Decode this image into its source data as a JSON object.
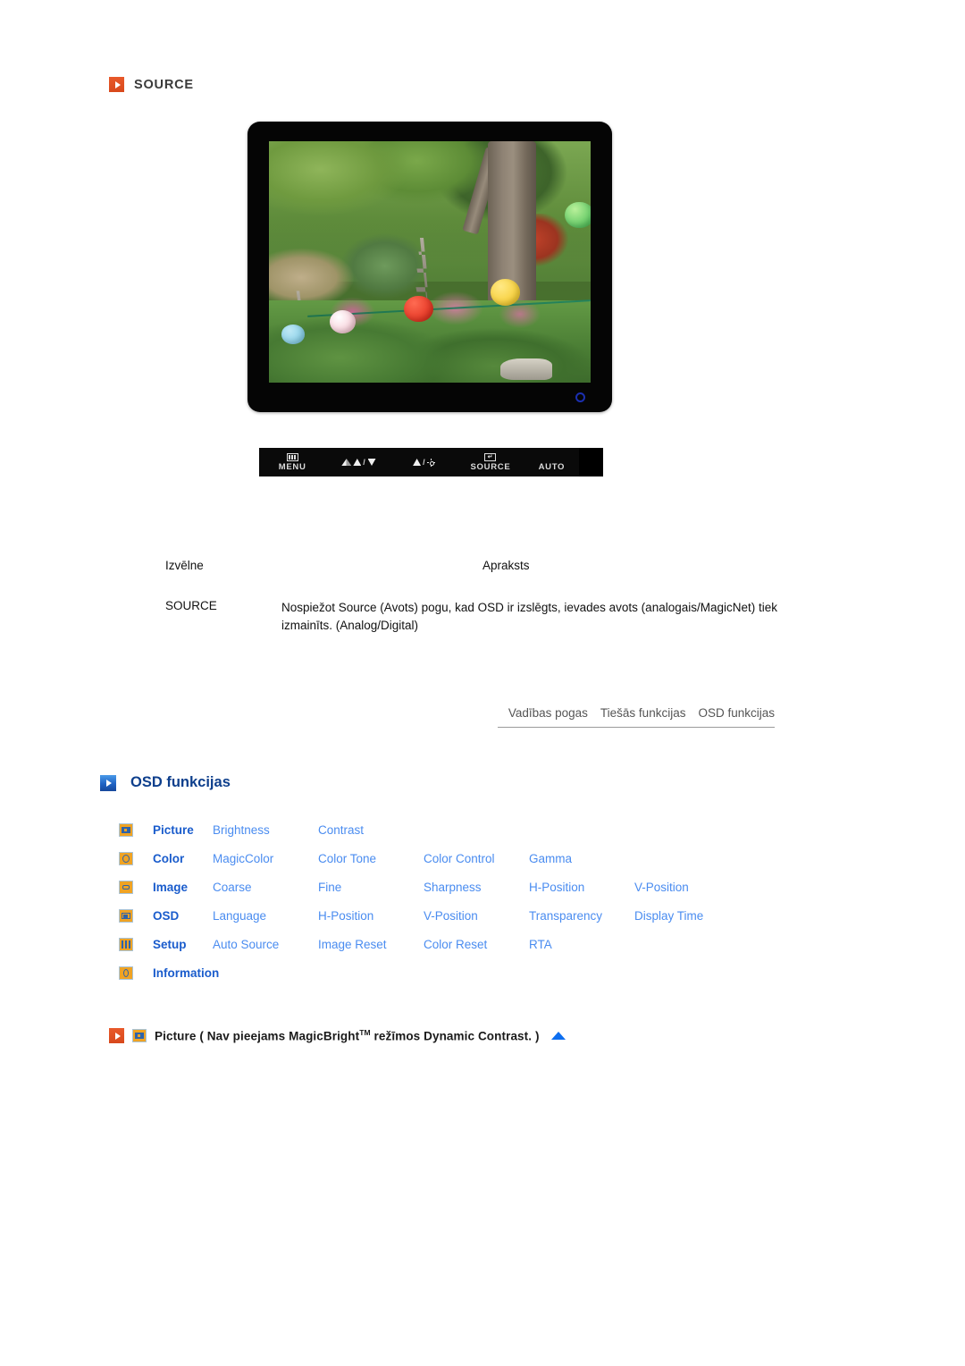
{
  "source_section": {
    "heading": "SOURCE",
    "bullet_icon": "orange-play-square-icon",
    "monitor": {
      "screen_image_alt": "korean-garden-with-stone-pagodas-and-paper-lanterns",
      "power_led": "blue-ring-power-indicator"
    },
    "control_panel": {
      "buttons": [
        {
          "label": "MENU",
          "icon": "menu-grid-icon"
        },
        {
          "label": "",
          "icon": "contrast-down-icon"
        },
        {
          "label": "",
          "icon": "brightness-up-icon"
        },
        {
          "label": "SOURCE",
          "icon": "enter-source-icon"
        },
        {
          "label": "AUTO",
          "icon": ""
        }
      ],
      "menu_label": "MENU",
      "source_label": "SOURCE",
      "auto_label": "AUTO"
    }
  },
  "description_table": {
    "headers": [
      "Izvēlne",
      "Apraksts"
    ],
    "rows": [
      {
        "menu": "SOURCE",
        "description": "Nospiežot Source (Avots) pogu, kad OSD ir izslēgts, ievades avots (analogais/MagicNet) tiek izmainīts. (Analog/Digital)"
      }
    ]
  },
  "tabs": [
    {
      "label": "Vadības pogas",
      "active": false
    },
    {
      "label": "Tiešās funkcijas",
      "active": false
    },
    {
      "label": "OSD funkcijas",
      "active": true
    }
  ],
  "osd_section": {
    "heading": "OSD funkcijas",
    "bullet_icon": "blue-play-square-icon",
    "menu_rows": [
      {
        "icon": "picture-icon",
        "category": "Picture",
        "items": [
          "Brightness",
          "Contrast"
        ]
      },
      {
        "icon": "color-icon",
        "category": "Color",
        "items": [
          "MagicColor",
          "Color Tone",
          "Color Control",
          "Gamma"
        ]
      },
      {
        "icon": "image-icon",
        "category": "Image",
        "items": [
          "Coarse",
          "Fine",
          "Sharpness",
          "H-Position",
          "V-Position"
        ]
      },
      {
        "icon": "osd-icon",
        "category": "OSD",
        "items": [
          "Language",
          "H-Position",
          "V-Position",
          "Transparency",
          "Display Time"
        ]
      },
      {
        "icon": "setup-icon",
        "category": "Setup",
        "items": [
          "Auto Source",
          "Image Reset",
          "Color Reset",
          "RTA"
        ]
      },
      {
        "icon": "information-icon",
        "category": "Information",
        "items": []
      }
    ]
  },
  "bottom_note": {
    "bullet_icon": "orange-play-square-icon",
    "menu_icon": "picture-icon",
    "text_before": "Picture ( Nav pieejams MagicBright",
    "superscript": "TM",
    "text_after": " režīmos Dynamic Contrast. )",
    "back_to_top_icon": "blue-up-arrow-icon"
  },
  "colors": {
    "orange_bullet": "#d8491c",
    "blue_bullet": "#1f63c4",
    "heading_blue": "#0e3f8c",
    "category_blue": "#1a5ccc",
    "item_blue": "#4a8cf0",
    "icon_orange": "#f0a323",
    "panel_black": "#0a0a0a"
  }
}
